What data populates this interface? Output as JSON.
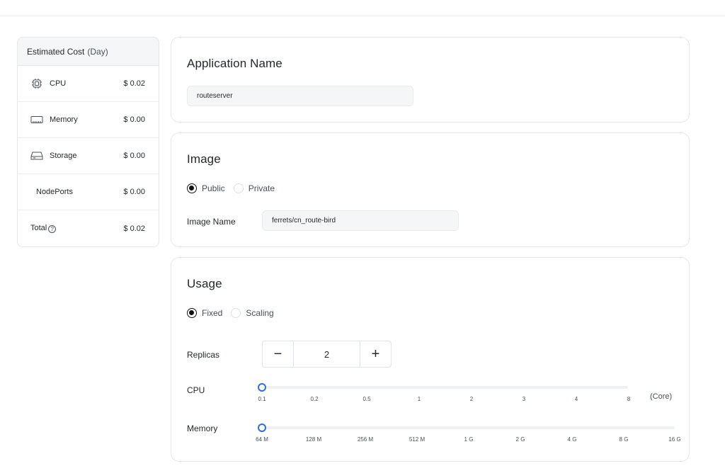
{
  "cost": {
    "title": "Estimated Cost",
    "period": "(Day)",
    "rows": [
      {
        "label": "CPU",
        "value": "$ 0.02",
        "icon": "cpu-icon"
      },
      {
        "label": "Memory",
        "value": "$ 0.00",
        "icon": "memory-icon"
      },
      {
        "label": "Storage",
        "value": "$ 0.00",
        "icon": "storage-icon"
      },
      {
        "label": "NodePorts",
        "value": "$ 0.00"
      },
      {
        "label": "Total",
        "value": "$ 0.02",
        "icon": "help-icon"
      }
    ]
  },
  "app": {
    "title": "Application Name",
    "name_value": "routeserver"
  },
  "image": {
    "title": "Image",
    "options": [
      "Public",
      "Private"
    ],
    "selected": "Public",
    "name_label": "Image Name",
    "name_value": "ferrets/cn_route-bird"
  },
  "usage": {
    "title": "Usage",
    "options": [
      "Fixed",
      "Scaling"
    ],
    "selected": "Fixed",
    "replicas_label": "Replicas",
    "replicas_value": "2",
    "minus": "−",
    "plus": "+",
    "cpu": {
      "label": "CPU",
      "ticks": [
        "0.1",
        "0.2",
        "0.5",
        "1",
        "2",
        "3",
        "4",
        "8"
      ],
      "unit": "(Core)",
      "selected": "0.1"
    },
    "memory": {
      "label": "Memory",
      "ticks": [
        "64 M",
        "128 M",
        "256 M",
        "512 M",
        "1 G",
        "2 G",
        "4 G",
        "8 G",
        "16 G"
      ],
      "selected": "64 M"
    }
  },
  "colors": {
    "accent": "#2f6bf0",
    "border": "#e6e8eb",
    "input_bg": "#f5f6f8"
  }
}
